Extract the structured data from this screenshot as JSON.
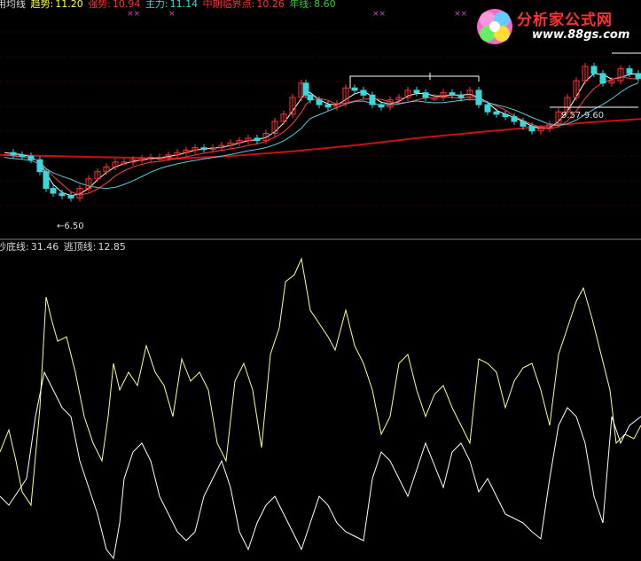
{
  "main_header": {
    "indicator_name": "用均线",
    "trend_label": "趋势:",
    "trend_value": "11.20",
    "strong_label": "强势:",
    "strong_value": "10.94",
    "main_label": "主力:",
    "main_value": "11.14",
    "critical_label": "中期临界点:",
    "critical_value": "10.26",
    "year_label": "年线:",
    "year_value": "8.60",
    "markers": [
      "××",
      "×",
      "××",
      "××"
    ]
  },
  "sub_header": {
    "bottom_label": "抄底线:",
    "bottom_value": "31.46",
    "top_label": "逃顶线:",
    "top_value": "12.85"
  },
  "logo": {
    "text": "分析家公式网",
    "url": "www.88gs.com"
  },
  "annotations": {
    "low_price": "←6.50",
    "range": "9.57-9.60"
  },
  "colors": {
    "up_candle": "#ff3333",
    "down_candle": "#3ad7dd",
    "year_line": "#cc1010",
    "ma_short": "#ffffff",
    "ma_mid": "#ff4040",
    "ma_long": "#55ccdd",
    "bottom_line": "#ffff88",
    "top_line": "#ffffff",
    "header_white": "#d8d8d8",
    "header_yellow": "#ffff44",
    "header_red": "#ff3030",
    "header_teal": "#33dddd",
    "header_green": "#33cc33",
    "marker_purple": "#cc44cc"
  },
  "chart_data": [
    {
      "type": "line",
      "name_hint": "price-panel",
      "ylim": [
        6,
        12
      ],
      "year_line": [
        [
          0,
          8.6
        ],
        [
          60,
          8.55
        ],
        [
          120,
          8.5
        ],
        [
          200,
          8.45
        ],
        [
          260,
          8.55
        ],
        [
          330,
          8.75
        ],
        [
          400,
          9.0
        ],
        [
          470,
          9.3
        ],
        [
          540,
          9.55
        ],
        [
          600,
          9.75
        ],
        [
          660,
          9.95
        ],
        [
          723,
          10.1
        ]
      ],
      "candles_points": [
        [
          5,
          8.7
        ],
        [
          15,
          8.6
        ],
        [
          25,
          8.55
        ],
        [
          35,
          8.4
        ],
        [
          45,
          7.9
        ],
        [
          52,
          7.2
        ],
        [
          60,
          7.0
        ],
        [
          70,
          6.9
        ],
        [
          80,
          6.8
        ],
        [
          90,
          7.2
        ],
        [
          100,
          7.6
        ],
        [
          110,
          7.9
        ],
        [
          120,
          8.1
        ],
        [
          130,
          8.3
        ],
        [
          140,
          8.3
        ],
        [
          150,
          8.4
        ],
        [
          160,
          8.45
        ],
        [
          170,
          8.5
        ],
        [
          180,
          8.5
        ],
        [
          190,
          8.6
        ],
        [
          200,
          8.7
        ],
        [
          210,
          8.8
        ],
        [
          220,
          8.9
        ],
        [
          230,
          8.85
        ],
        [
          240,
          8.9
        ],
        [
          250,
          9.0
        ],
        [
          260,
          9.1
        ],
        [
          270,
          9.2
        ],
        [
          280,
          9.3
        ],
        [
          290,
          9.2
        ],
        [
          300,
          9.5
        ],
        [
          310,
          10.0
        ],
        [
          320,
          10.3
        ],
        [
          330,
          11.0
        ],
        [
          340,
          11.6
        ],
        [
          345,
          11.1
        ],
        [
          350,
          10.9
        ],
        [
          360,
          10.7
        ],
        [
          370,
          10.6
        ],
        [
          380,
          10.75
        ],
        [
          390,
          11.4
        ],
        [
          400,
          11.3
        ],
        [
          410,
          11.1
        ],
        [
          420,
          10.7
        ],
        [
          430,
          10.6
        ],
        [
          440,
          10.9
        ],
        [
          450,
          11.0
        ],
        [
          460,
          11.3
        ],
        [
          470,
          11.2
        ],
        [
          480,
          11.0
        ],
        [
          490,
          11.0
        ],
        [
          500,
          11.2
        ],
        [
          510,
          11.1
        ],
        [
          520,
          11.0
        ],
        [
          530,
          11.3
        ],
        [
          540,
          10.7
        ],
        [
          550,
          10.4
        ],
        [
          560,
          10.3
        ],
        [
          570,
          10.2
        ],
        [
          580,
          10.0
        ],
        [
          590,
          9.8
        ],
        [
          600,
          9.6
        ],
        [
          610,
          9.7
        ],
        [
          620,
          9.9
        ],
        [
          630,
          10.4
        ],
        [
          640,
          11.0
        ],
        [
          650,
          11.7
        ],
        [
          660,
          12.3
        ],
        [
          670,
          12.0
        ],
        [
          680,
          11.6
        ],
        [
          690,
          11.7
        ],
        [
          700,
          12.2
        ],
        [
          710,
          12.0
        ],
        [
          720,
          11.8
        ]
      ],
      "annotations": [
        "←6.50",
        "9.57-9.60"
      ]
    },
    {
      "type": "line",
      "name_hint": "oscillator-panel",
      "series": [
        {
          "name": "抄底线",
          "values": [
            [
              0,
              510
            ],
            [
              10,
              485
            ],
            [
              18,
              520
            ],
            [
              25,
              555
            ],
            [
              35,
              570
            ],
            [
              45,
              460
            ],
            [
              52,
              335
            ],
            [
              58,
              360
            ],
            [
              65,
              385
            ],
            [
              75,
              380
            ],
            [
              85,
              420
            ],
            [
              95,
              470
            ],
            [
              105,
              500
            ],
            [
              115,
              520
            ],
            [
              122,
              470
            ],
            [
              128,
              410
            ],
            [
              135,
              440
            ],
            [
              145,
              420
            ],
            [
              155,
              435
            ],
            [
              165,
              390
            ],
            [
              175,
              420
            ],
            [
              185,
              435
            ],
            [
              195,
              470
            ],
            [
              205,
              405
            ],
            [
              215,
              430
            ],
            [
              225,
              420
            ],
            [
              235,
              440
            ],
            [
              245,
              500
            ],
            [
              255,
              520
            ],
            [
              265,
              430
            ],
            [
              275,
              410
            ],
            [
              285,
              440
            ],
            [
              295,
              505
            ],
            [
              305,
              400
            ],
            [
              315,
              370
            ],
            [
              322,
              318
            ],
            [
              332,
              310
            ],
            [
              340,
              292
            ],
            [
              350,
              350
            ],
            [
              360,
              365
            ],
            [
              370,
              380
            ],
            [
              378,
              395
            ],
            [
              390,
              350
            ],
            [
              400,
              390
            ],
            [
              410,
              410
            ],
            [
              420,
              440
            ],
            [
              430,
              490
            ],
            [
              440,
              470
            ],
            [
              450,
              410
            ],
            [
              460,
              400
            ],
            [
              470,
              440
            ],
            [
              480,
              470
            ],
            [
              490,
              445
            ],
            [
              500,
              435
            ],
            [
              510,
              460
            ],
            [
              520,
              480
            ],
            [
              530,
              500
            ],
            [
              540,
              405
            ],
            [
              550,
              410
            ],
            [
              560,
              420
            ],
            [
              570,
              460
            ],
            [
              580,
              430
            ],
            [
              590,
              415
            ],
            [
              600,
              410
            ],
            [
              610,
              440
            ],
            [
              620,
              480
            ],
            [
              630,
              400
            ],
            [
              640,
              370
            ],
            [
              650,
              340
            ],
            [
              658,
              325
            ],
            [
              668,
              360
            ],
            [
              678,
              400
            ],
            [
              688,
              440
            ],
            [
              695,
              500
            ],
            [
              705,
              490
            ],
            [
              715,
              495
            ],
            [
              723,
              480
            ]
          ]
        },
        {
          "name": "逃顶线",
          "values": [
            [
              0,
              560
            ],
            [
              10,
              570
            ],
            [
              20,
              555
            ],
            [
              30,
              540
            ],
            [
              40,
              470
            ],
            [
              50,
              420
            ],
            [
              60,
              440
            ],
            [
              70,
              460
            ],
            [
              80,
              470
            ],
            [
              90,
              520
            ],
            [
              100,
              550
            ],
            [
              110,
              580
            ],
            [
              120,
              620
            ],
            [
              128,
              630
            ],
            [
              135,
              590
            ],
            [
              140,
              540
            ],
            [
              150,
              510
            ],
            [
              160,
              500
            ],
            [
              170,
              520
            ],
            [
              180,
              560
            ],
            [
              190,
              580
            ],
            [
              200,
              600
            ],
            [
              210,
              610
            ],
            [
              220,
              600
            ],
            [
              230,
              560
            ],
            [
              240,
              540
            ],
            [
              250,
              520
            ],
            [
              260,
              550
            ],
            [
              270,
              600
            ],
            [
              280,
              620
            ],
            [
              290,
              590
            ],
            [
              300,
              570
            ],
            [
              310,
              560
            ],
            [
              320,
              580
            ],
            [
              330,
              600
            ],
            [
              340,
              620
            ],
            [
              350,
              590
            ],
            [
              360,
              560
            ],
            [
              370,
              570
            ],
            [
              380,
              590
            ],
            [
              390,
              600
            ],
            [
              400,
              605
            ],
            [
              410,
              610
            ],
            [
              420,
              540
            ],
            [
              430,
              510
            ],
            [
              440,
              520
            ],
            [
              450,
              540
            ],
            [
              460,
              560
            ],
            [
              470,
              530
            ],
            [
              480,
              500
            ],
            [
              490,
              525
            ],
            [
              500,
              550
            ],
            [
              510,
              510
            ],
            [
              520,
              500
            ],
            [
              530,
              520
            ],
            [
              540,
              555
            ],
            [
              550,
              540
            ],
            [
              560,
              560
            ],
            [
              570,
              580
            ],
            [
              580,
              585
            ],
            [
              590,
              590
            ],
            [
              600,
              600
            ],
            [
              610,
              608
            ],
            [
              620,
              540
            ],
            [
              630,
              480
            ],
            [
              640,
              460
            ],
            [
              650,
              470
            ],
            [
              660,
              500
            ],
            [
              670,
              560
            ],
            [
              680,
              590
            ],
            [
              690,
              470
            ],
            [
              700,
              500
            ],
            [
              710,
              480
            ],
            [
              723,
              470
            ]
          ]
        }
      ]
    }
  ]
}
